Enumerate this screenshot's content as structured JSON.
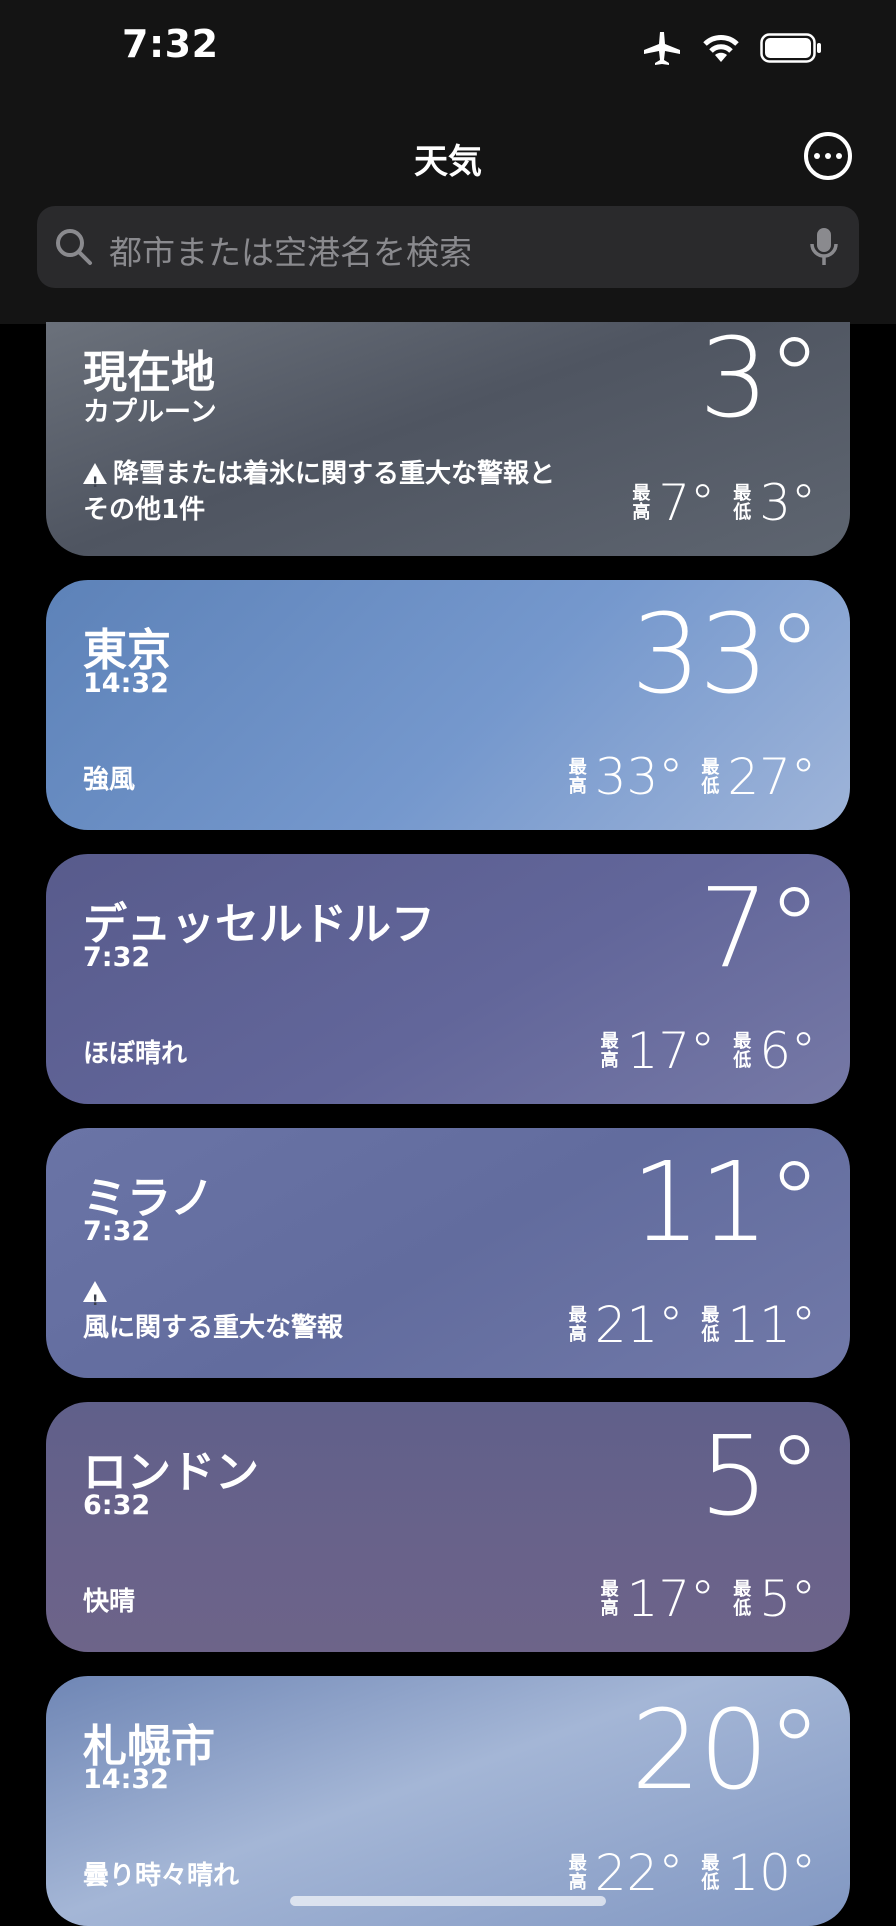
{
  "status": {
    "time": "7:32",
    "icons": [
      "airplane-icon",
      "wifi-icon",
      "battery-icon"
    ]
  },
  "header": {
    "title": "天気",
    "more_icon": "ellipsis-circle-icon"
  },
  "search": {
    "placeholder": "都市または空港名を検索",
    "icons": [
      "search-icon",
      "mic-icon"
    ]
  },
  "labels": {
    "high": [
      "最",
      "高"
    ],
    "low": [
      "最",
      "低"
    ]
  },
  "cards": [
    {
      "name": "現在地",
      "sub": "カプルーン",
      "temp": "3°",
      "condition_line1": "降雪または着氷に関する重大な警報と",
      "condition_line2": "その他1件",
      "high": "7°",
      "low": "3°",
      "warning": true
    },
    {
      "name": "東京",
      "sub": "14:32",
      "temp": "33°",
      "condition": "強風",
      "high": "33°",
      "low": "27°"
    },
    {
      "name": "デュッセルドルフ",
      "sub": "7:32",
      "temp": "7°",
      "condition": "ほぼ晴れ",
      "high": "17°",
      "low": "6°"
    },
    {
      "name": "ミラノ",
      "sub": "7:32",
      "temp": "11°",
      "condition": "風に関する重大な警報",
      "high": "21°",
      "low": "11°",
      "warning": true
    },
    {
      "name": "ロンドン",
      "sub": "6:32",
      "temp": "5°",
      "condition": "快晴",
      "high": "17°",
      "low": "5°"
    },
    {
      "name": "札幌市",
      "sub": "14:32",
      "temp": "20°",
      "condition": "曇り時々晴れ",
      "high": "22°",
      "low": "10°"
    }
  ],
  "colors": {
    "card_bg_current": "#5a606c",
    "card_bg_tokyo": "#6b8fc5",
    "card_bg_dusseldorf": "#5f6494",
    "card_bg_milan": "#6770a0",
    "card_bg_london": "#67628a",
    "card_bg_sapporo": "#8fa5c8"
  }
}
